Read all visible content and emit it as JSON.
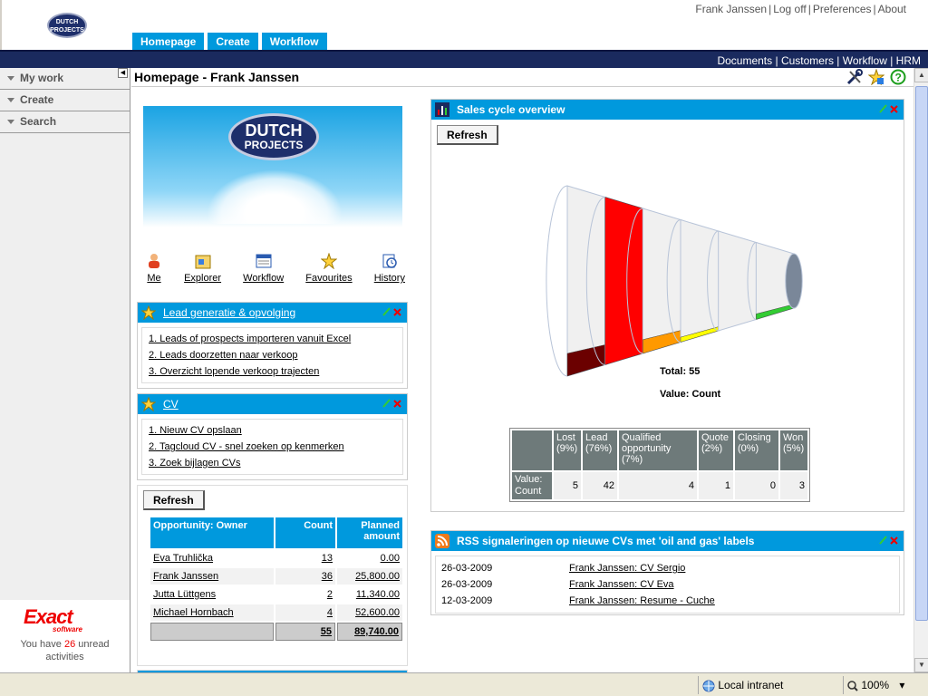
{
  "header": {
    "user_name": "Frank Janssen",
    "logoff": "Log off",
    "preferences": "Preferences",
    "about": "About",
    "logo_text_1": "DUTCH",
    "logo_text_2": "PROJECTS"
  },
  "main_tabs": [
    "Homepage",
    "Create",
    "Workflow"
  ],
  "secondary_links": [
    "Documents",
    "Customers",
    "Workflow",
    "HRM"
  ],
  "sidebar": {
    "items": [
      "My work",
      "Create",
      "Search"
    ],
    "exact_logo": "Exact",
    "exact_sub": "software",
    "unread_prefix": "You have",
    "unread_count": "26",
    "unread_suffix": "unread activities"
  },
  "page": {
    "title": "Homepage - Frank Janssen"
  },
  "banner": {
    "line1": "DUTCH",
    "line2": "PROJECTS"
  },
  "quick_links": [
    "Me",
    "Explorer",
    "Workflow",
    "Favourites",
    "History"
  ],
  "lead_widget": {
    "title": "Lead generatie & opvolging",
    "items": [
      "1. Leads of prospects importeren vanuit Excel",
      "2. Leads doorzetten naar verkoop",
      "3. Overzicht lopende verkoop trajecten"
    ]
  },
  "cv_widget": {
    "title": "CV",
    "items": [
      "1. Nieuw CV opslaan",
      "2. Tagcloud CV - snel zoeken op kenmerken",
      "3. Zoek bijlagen CVs"
    ]
  },
  "opportunity_widget": {
    "refresh": "Refresh",
    "headers": [
      "Opportunity: Owner",
      "Count",
      "Planned amount"
    ],
    "rows": [
      {
        "owner": "Eva Truhlička",
        "count": "13",
        "amount": "0.00"
      },
      {
        "owner": "Frank Janssen",
        "count": "36",
        "amount": "25,800.00"
      },
      {
        "owner": "Jutta Lüttgens",
        "count": "2",
        "amount": "11,340.00"
      },
      {
        "owner": "Michael Hornbach",
        "count": "4",
        "amount": "52,600.00"
      }
    ],
    "total_count": "55",
    "total_amount": "89,740.00"
  },
  "sales_widget": {
    "title": "Sales cycle overview",
    "refresh": "Refresh",
    "total_label": "Total: 55",
    "value_label": "Value: Count",
    "row_label": "Value: Count",
    "colors": {
      "lost": "#6b0000",
      "lead": "#ff0000",
      "qualified": "#ff9900",
      "quote": "#ffff00",
      "won": "#33cc33"
    }
  },
  "chart_data": {
    "type": "table",
    "stages": [
      {
        "name": "Lost (9%)",
        "value": 5
      },
      {
        "name": "Lead (76%)",
        "value": 42
      },
      {
        "name": "Qualified opportunity (7%)",
        "value": 4
      },
      {
        "name": "Quote (2%)",
        "value": 1
      },
      {
        "name": "Closing (0%)",
        "value": 0
      },
      {
        "name": "Won (5%)",
        "value": 3
      }
    ],
    "total": 55
  },
  "rss_widget": {
    "title": "RSS signaleringen op nieuwe CVs met 'oil and gas' labels",
    "rows": [
      {
        "date": "26-03-2009",
        "link": "Frank Janssen: CV Sergio"
      },
      {
        "date": "26-03-2009",
        "link": "Frank Janssen: CV Eva"
      },
      {
        "date": "12-03-2009",
        "link": "Frank Janssen: Resume - Cuche"
      }
    ]
  },
  "statusbar": {
    "zone": "Local intranet",
    "zoom": "100%"
  }
}
